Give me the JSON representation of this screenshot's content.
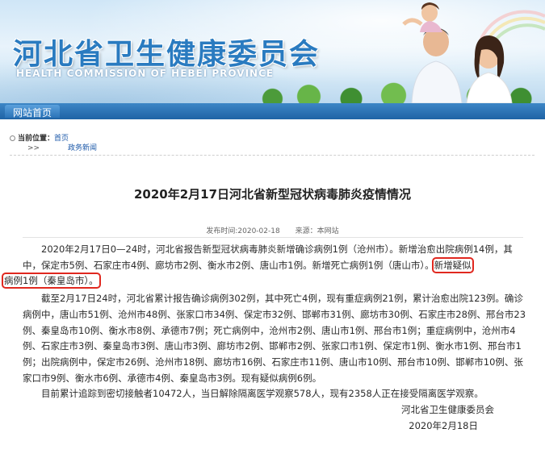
{
  "header": {
    "title": "河北省卫生健康委员会",
    "subtitle": "HEALTH COMMISSION OF HEBEI PROVINCE",
    "nav_home": "网站首页"
  },
  "breadcrumb": {
    "label": "当前位置：",
    "home": "首页",
    "arrows": ">>",
    "current": "政务新闻"
  },
  "article": {
    "title": "2020年2月17日河北省新型冠状病毒肺炎疫情情况",
    "publish_label": "发布时间:2020-02-18",
    "source_label": "来源：本网站",
    "p1_a": "2020年2月17日0—24时，河北省报告新型冠状病毒肺炎新增确诊病例1例（沧州市）。新增治愈出院病例14例，其中，保定市5例、石家庄市4例、廊坊市2例、衡水市2例、唐山市1例。新增死亡病例1例（唐山市）。",
    "p1_hl1": "新增疑似",
    "p1_hl2": "病例1例（秦皇岛市）。",
    "p2": "截至2月17日24时，河北省累计报告确诊病例302例，其中死亡4例，现有重症病例21例，累计治愈出院123例。确诊病例中，唐山市51例、沧州市48例、张家口市34例、保定市32例、邯郸市31例、廊坊市30例、石家庄市28例、邢台市23例、秦皇岛市10例、衡水市8例、承德市7例；死亡病例中，沧州市2例、唐山市1例、邢台市1例；重症病例中，沧州市4例、石家庄市3例、秦皇岛市3例、唐山市3例、廊坊市2例、邯郸市2例、张家口市1例、保定市1例、衡水市1例、邢台市1例；出院病例中，保定市26例、沧州市18例、廊坊市16例、石家庄市11例、唐山市10例、邢台市10例、邯郸市10例、张家口市9例、衡水市6例、承德市4例、秦皇岛市3例。现有疑似病例6例。",
    "p3": "目前累计追踪到密切接触者10472人，当日解除隔离医学观察578人，现有2358人正在接受隔离医学观察。",
    "signature": "河北省卫生健康委员会",
    "date": "2020年2月18日"
  },
  "colors": {
    "title_blue": "#2a7bc0",
    "nav_blue": "#1f63a5",
    "highlight_red": "#e0281f"
  }
}
